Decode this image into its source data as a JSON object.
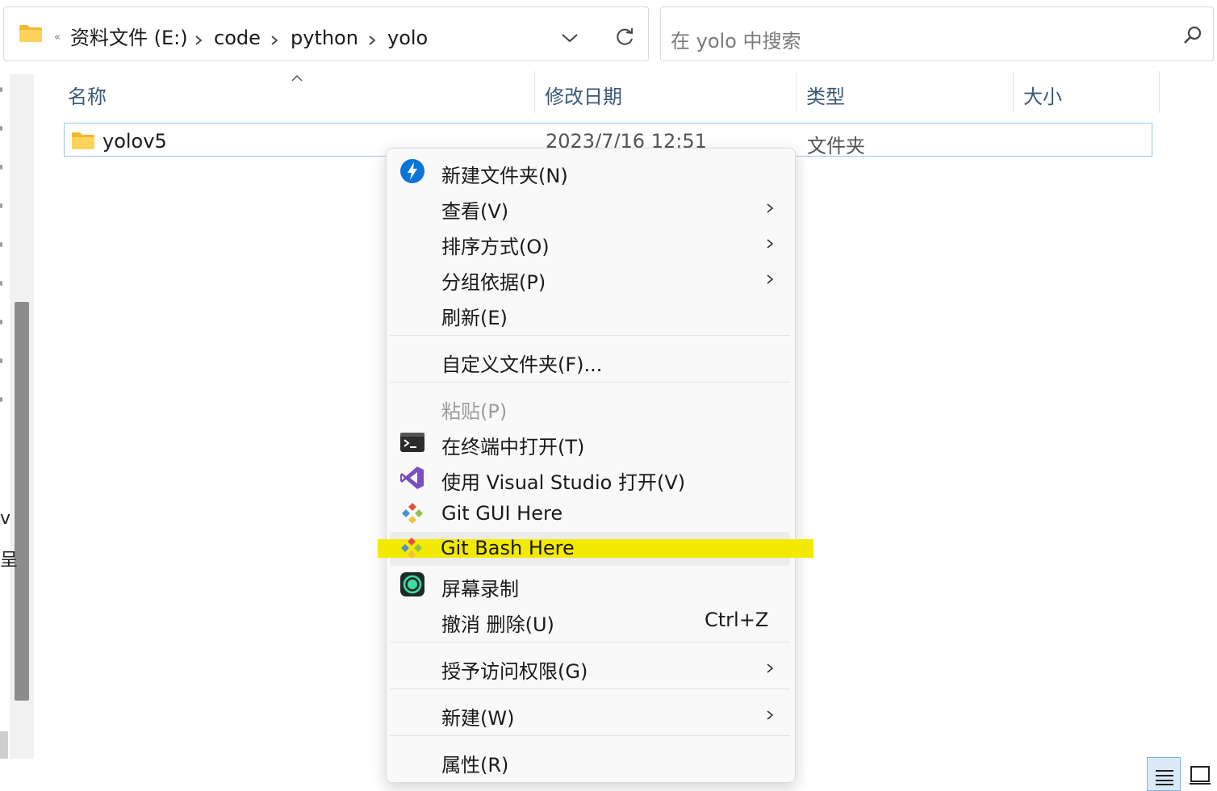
{
  "address": {
    "overflow_chevron": "«",
    "crumbs": [
      "资料文件 (E:)",
      "code",
      "python",
      "yolo"
    ]
  },
  "search": {
    "placeholder": "在 yolo 中搜索"
  },
  "columns": {
    "name": "名称",
    "modified": "修改日期",
    "type": "类型",
    "size": "大小"
  },
  "files": [
    {
      "name": "yolov5",
      "modified": "2023/7/16 12:51",
      "type": "文件夹",
      "size": ""
    }
  ],
  "nav_fragments": [
    "v",
    "呈"
  ],
  "context_menu": {
    "items": {
      "new_folder": "新建文件夹(N)",
      "view": "查看(V)",
      "sort": "排序方式(O)",
      "group": "分组依据(P)",
      "refresh": "刷新(E)",
      "customize": "自定义文件夹(F)...",
      "paste": "粘贴(P)",
      "open_terminal": "在终端中打开(T)",
      "open_vs": "使用 Visual Studio 打开(V)",
      "git_gui": "Git GUI Here",
      "git_bash": "Git Bash Here",
      "screen_record": "屏幕录制",
      "undo_delete": "撤消 删除(U)",
      "undo_shortcut": "Ctrl+Z",
      "grant_access": "授予访问权限(G)",
      "new": "新建(W)",
      "properties": "属性(R)"
    },
    "highlight_color": "#f2ea00"
  },
  "colors": {
    "header_text": "#3c5878",
    "selection_border": "#99c6ea",
    "accent": "#0078d4"
  }
}
